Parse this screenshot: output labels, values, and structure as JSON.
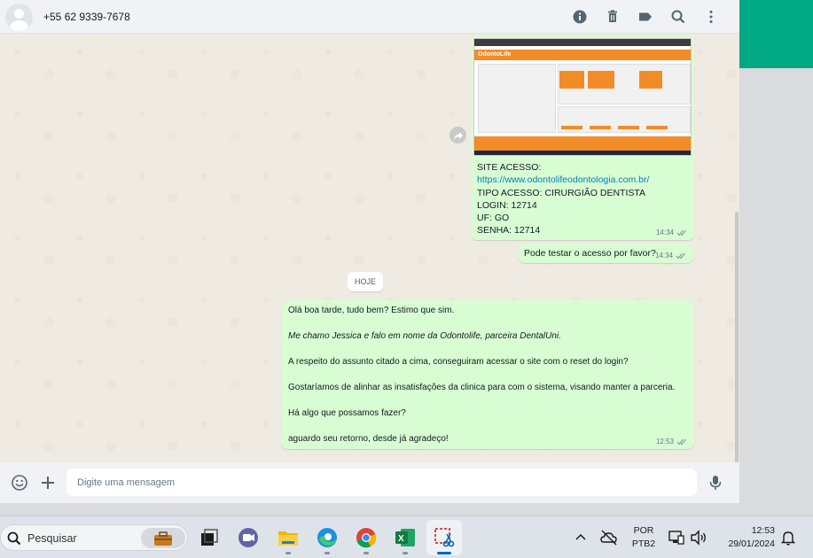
{
  "header": {
    "contact_name": "+55 62 9339-7678"
  },
  "icons": {
    "header": [
      "info-icon",
      "trash-icon",
      "label-icon",
      "search-icon",
      "more-vert-icon"
    ],
    "footer": [
      "emoji-icon",
      "plus-icon",
      "mic-icon"
    ]
  },
  "messages": {
    "info_card": {
      "lines": [
        "SITE ACESSO:",
        "https://www.odontolifeodontologia.com.br/",
        "TIPO ACESSO: CIRURGIÃO DENTISTA",
        "LOGIN: 12714",
        "UF: GO",
        "SENHA: 12714"
      ],
      "time": "14:34"
    },
    "test_request": {
      "text": "Pode testar o acesso por favor?",
      "time": "14:34"
    },
    "date_divider": "HOJE",
    "reply": {
      "paragraphs": [
        "Olá boa tarde, tudo bem? Estimo que sim.",
        "Me chamo Jessica e falo em nome da Odontolife, parceira DentalUni.",
        "A respeito do assunto citado a cima, conseguiram acessar o site com o reset do login?",
        "Gostaríamos de alinhar as insatisfações da clinica para com o sistema, visando manter a parceria.",
        "Há algo que possamos fazer?",
        "aguardo seu retorno, desde já agradeço!"
      ],
      "time": "12:53"
    }
  },
  "composer": {
    "placeholder": "Digite uma mensagem"
  },
  "taskbar": {
    "search_label": "Pesquisar",
    "language_line1": "POR",
    "language_line2": "PTB2",
    "time": "12:53",
    "date": "29/01/2024"
  },
  "colors": {
    "outgoing_bubble": "#d9fdd3",
    "accent_green": "#00a884",
    "link": "#027eb5"
  }
}
